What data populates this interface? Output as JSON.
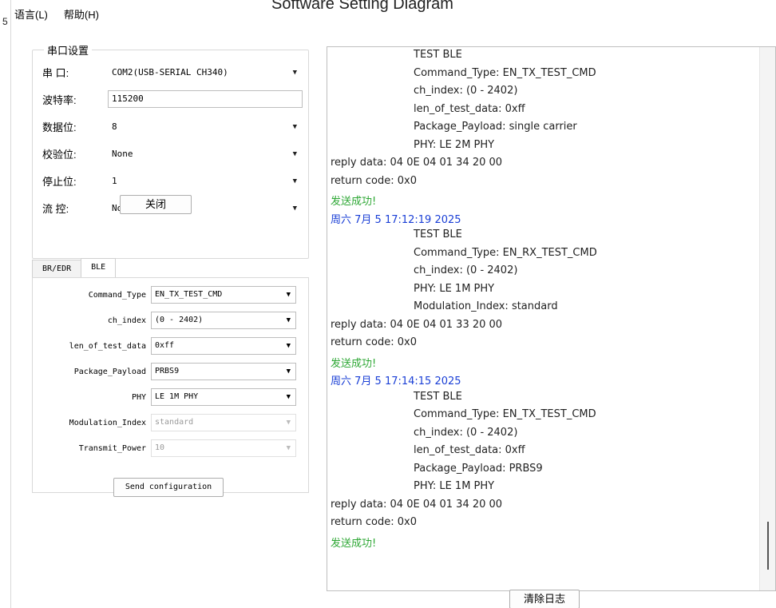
{
  "left_digit": "5",
  "doc_title": "Software Setting Diagram",
  "menu": [
    "语言(L)",
    "帮助(H)"
  ],
  "serial": {
    "legend": "串口设置",
    "rows": [
      {
        "label": "串  口:",
        "value": "COM2(USB-SERIAL CH340)"
      },
      {
        "label": "波特率:",
        "value": "115200"
      },
      {
        "label": "数据位:",
        "value": "8"
      },
      {
        "label": "校验位:",
        "value": "None"
      },
      {
        "label": "停止位:",
        "value": "1"
      },
      {
        "label": "流  控:",
        "value": "NoFlow"
      }
    ],
    "close_button": "关闭"
  },
  "tabs": [
    "BR/EDR",
    "BLE"
  ],
  "ble": {
    "rows": [
      {
        "label": "Command_Type",
        "value": "EN_TX_TEST_CMD"
      },
      {
        "label": "ch_index",
        "value": "(0 - 2402)"
      },
      {
        "label": "len_of_test_data",
        "value": "0xff"
      },
      {
        "label": "Package_Payload",
        "value": "PRBS9"
      },
      {
        "label": "PHY",
        "value": "LE 1M PHY"
      },
      {
        "label": "Modulation_Index",
        "value": "standard"
      },
      {
        "label": "Transmit_Power",
        "value": "10"
      }
    ],
    "send_button": "Send configuration"
  },
  "log": {
    "lines": [
      {
        "text": "TEST BLE",
        "color": "black",
        "indent": true
      },
      {
        "text": "Command_Type: EN_TX_TEST_CMD",
        "color": "black",
        "indent": true
      },
      {
        "text": "ch_index: (0 - 2402)",
        "color": "black",
        "indent": true
      },
      {
        "text": "len_of_test_data: 0xff",
        "color": "black",
        "indent": true
      },
      {
        "text": "Package_Payload: single carrier",
        "color": "black",
        "indent": true
      },
      {
        "text": "PHY: LE 2M PHY",
        "color": "black",
        "indent": true
      },
      {
        "text": "reply data: 04 0E 04 01 34 20 00",
        "color": "black",
        "indent": false
      },
      {
        "text": "return code: 0x0",
        "color": "black",
        "indent": false
      },
      {
        "text": "发送成功!",
        "color": "green",
        "indent": false
      },
      {
        "text": "周六 7月 5 17:12:19 2025",
        "color": "blue",
        "indent": false
      },
      {
        "text": "TEST BLE",
        "color": "black",
        "indent": true
      },
      {
        "text": "Command_Type: EN_RX_TEST_CMD",
        "color": "black",
        "indent": true
      },
      {
        "text": "ch_index: (0 - 2402)",
        "color": "black",
        "indent": true
      },
      {
        "text": "PHY: LE 1M PHY",
        "color": "black",
        "indent": true
      },
      {
        "text": "Modulation_Index: standard",
        "color": "black",
        "indent": true
      },
      {
        "text": "reply data: 04 0E 04 01 33 20 00",
        "color": "black",
        "indent": false
      },
      {
        "text": "return code: 0x0",
        "color": "black",
        "indent": false
      },
      {
        "text": "发送成功!",
        "color": "green",
        "indent": false
      },
      {
        "text": "周六 7月 5 17:14:15 2025",
        "color": "blue",
        "indent": false
      },
      {
        "text": "TEST BLE",
        "color": "black",
        "indent": true
      },
      {
        "text": "Command_Type: EN_TX_TEST_CMD",
        "color": "black",
        "indent": true
      },
      {
        "text": "ch_index: (0 - 2402)",
        "color": "black",
        "indent": true
      },
      {
        "text": "len_of_test_data: 0xff",
        "color": "black",
        "indent": true
      },
      {
        "text": "Package_Payload: PRBS9",
        "color": "black",
        "indent": true
      },
      {
        "text": "PHY: LE 1M PHY",
        "color": "black",
        "indent": true
      },
      {
        "text": "reply data: 04 0E 04 01 34 20 00",
        "color": "black",
        "indent": false
      },
      {
        "text": "return code: 0x0",
        "color": "black",
        "indent": false
      },
      {
        "text": "发送成功!",
        "color": "green",
        "indent": false
      }
    ],
    "clear_button": "清除日志"
  },
  "colors": {
    "success": "#2fa836",
    "timestamp": "#1a3fd6"
  }
}
